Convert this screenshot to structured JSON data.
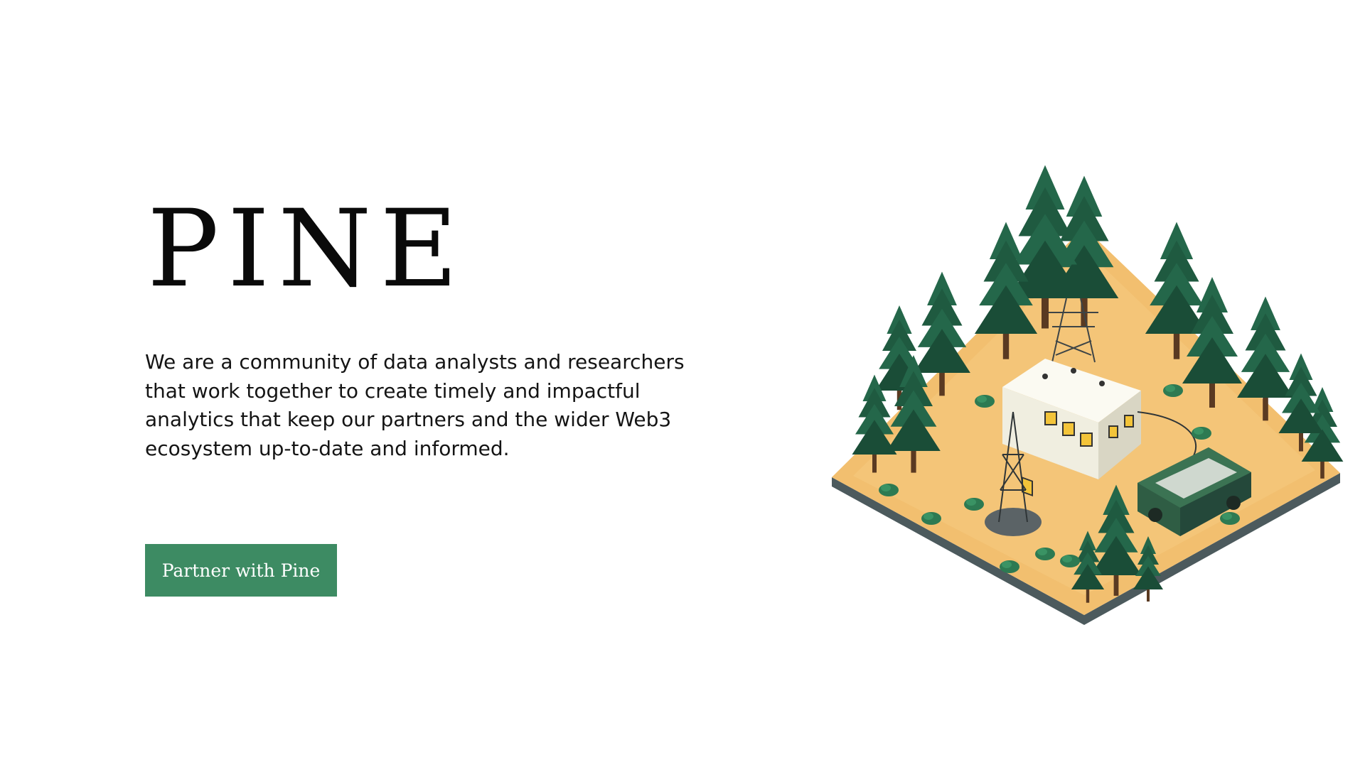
{
  "hero": {
    "title": "PINE",
    "description": "We are a community of data analysts and researchers that work together to create timely and impactful analytics that keep our partners and the wider Web3 ecosystem up-to-date and informed.",
    "cta_label": "Partner with Pine"
  },
  "colors": {
    "accent": "#3d8b63",
    "text": "#141414",
    "ground": "#f2bf6f",
    "tree": "#1f5a40",
    "building": "#f3f1e6"
  },
  "illustration": {
    "icon": "isometric-forest-research-station-illustration"
  }
}
